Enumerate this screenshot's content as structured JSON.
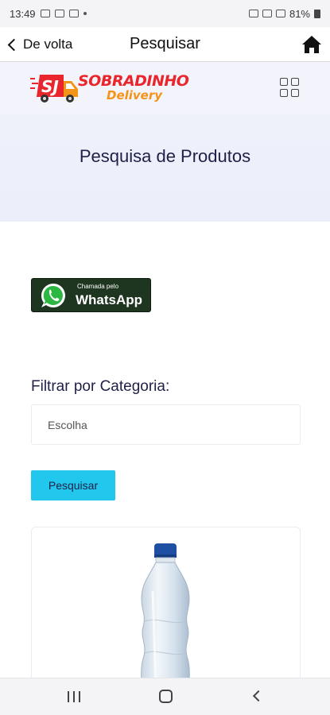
{
  "status_bar": {
    "time": "13:49",
    "battery": "81%"
  },
  "app_bar": {
    "back_label": "De volta",
    "title": "Pesquisar"
  },
  "logo": {
    "line1": "SOBRADINHO",
    "line2": "Delivery"
  },
  "hero": {
    "title": "Pesquisa de Produtos"
  },
  "whatsapp": {
    "small": "Chamada pelo",
    "big": "WhatsApp"
  },
  "filter": {
    "label": "Filtrar por Categoria:",
    "select_value": "Escolha",
    "search_button": "Pesquisar"
  },
  "colors": {
    "accent": "#22c7ee",
    "hero_bg": "#eef0fa",
    "title_text": "#1e2048",
    "whatsapp_bg": "#1e3520",
    "logo_red": "#e8262b",
    "logo_orange": "#f39318"
  },
  "icons": [
    "back-chevron-icon",
    "home-icon",
    "grid-menu-icon",
    "whatsapp-icon",
    "nav-recents-icon",
    "nav-home-icon",
    "nav-back-icon"
  ]
}
